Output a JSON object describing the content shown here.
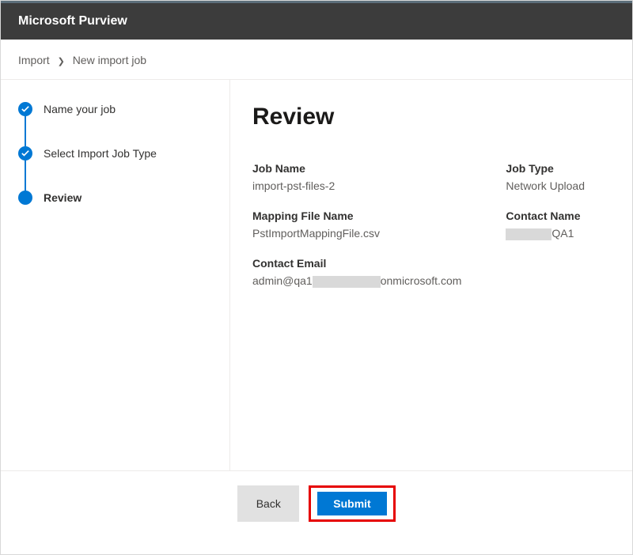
{
  "header": {
    "title": "Microsoft Purview"
  },
  "breadcrumb": {
    "root": "Import",
    "current": "New import job"
  },
  "steps": {
    "s1": "Name your job",
    "s2": "Select Import Job Type",
    "s3": "Review"
  },
  "main": {
    "title": "Review",
    "fields": {
      "job_name_label": "Job Name",
      "job_name_value": "import-pst-files-2",
      "mapping_file_label": "Mapping File Name",
      "mapping_file_value": "PstImportMappingFile.csv",
      "contact_email_label": "Contact Email",
      "contact_email_prefix": "admin@qa1",
      "contact_email_suffix": "onmicrosoft.com",
      "job_type_label": "Job Type",
      "job_type_value": "Network Upload",
      "contact_name_label": "Contact Name",
      "contact_name_suffix": "QA1"
    }
  },
  "footer": {
    "back": "Back",
    "submit": "Submit"
  }
}
